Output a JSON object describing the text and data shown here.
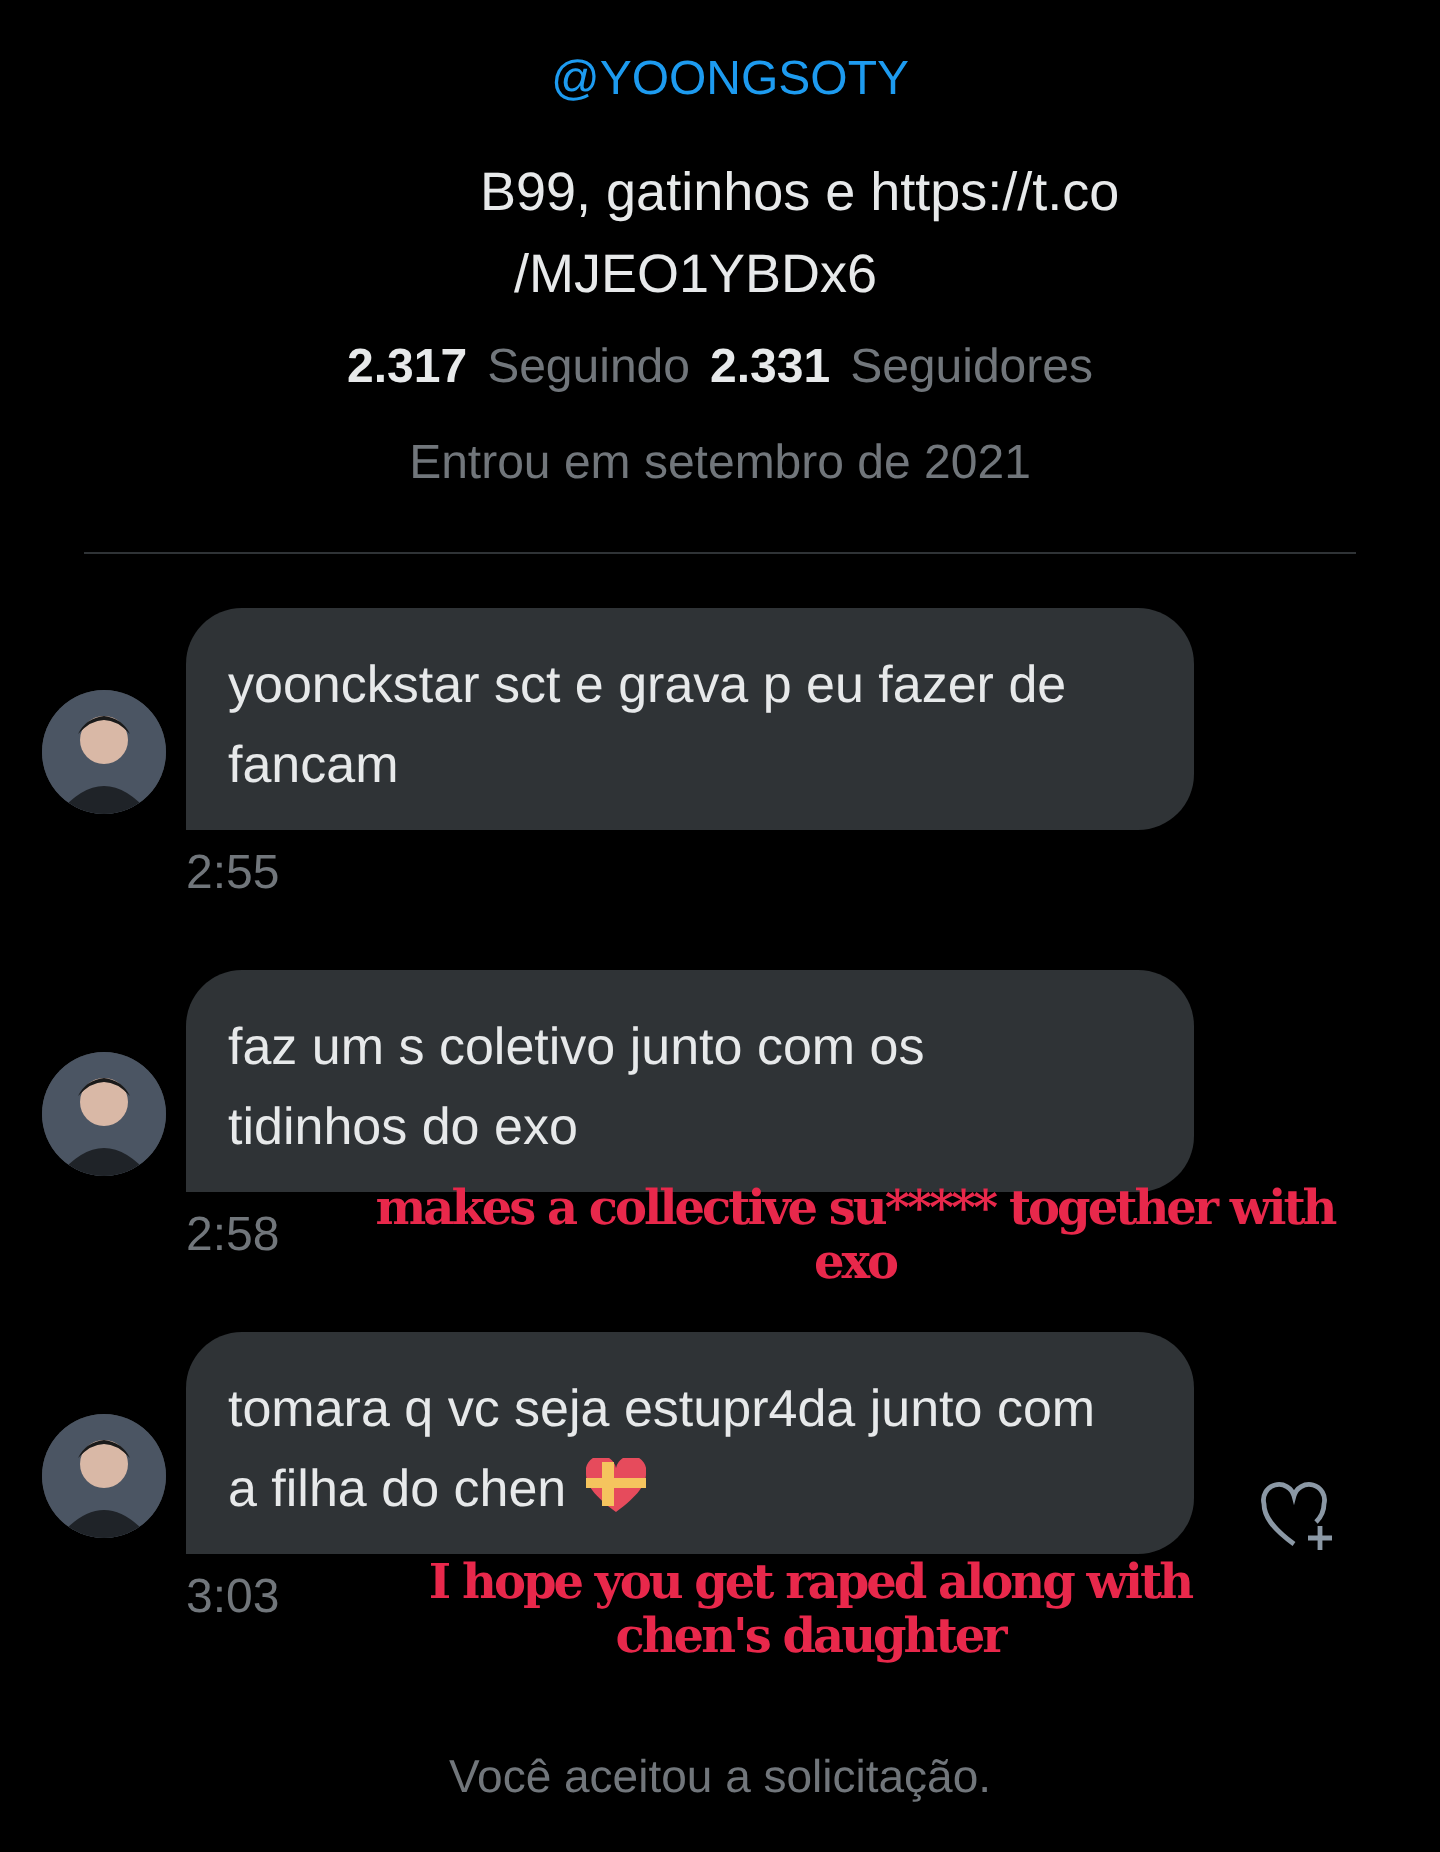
{
  "profile": {
    "handle": "@YOONGSOTY",
    "bio_lines": [
      "B99, gatinhos e https://t.co",
      "/MJEO1YBDx6"
    ],
    "following_count": "2.317",
    "following_label": "Seguindo",
    "followers_count": "2.331",
    "followers_label": "Seguidores",
    "joined": "Entrou em setembro de 2021"
  },
  "messages": [
    {
      "text": "yoonckstar sct e grava p eu fazer de fancam",
      "time": "2:55",
      "emoji": false,
      "like_button": false
    },
    {
      "text": "faz um s coletivo junto com os tidinhos do exo",
      "time": "2:58",
      "emoji": false,
      "like_button": false,
      "annotation": "makes a collective su***** together with exo"
    },
    {
      "text": "tomara q vc seja estupr4da junto com a filha do chen",
      "time": "3:03",
      "emoji": true,
      "like_button": true,
      "annotation": "I hope you get raped along with chen's daughter"
    }
  ],
  "footer": "Você aceitou a solicitação."
}
